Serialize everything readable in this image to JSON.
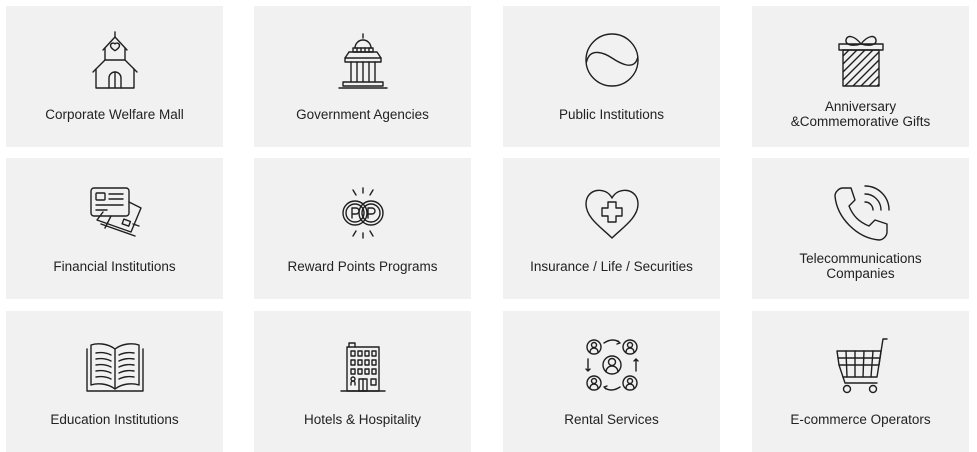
{
  "colors": {
    "card_background": "#f1f1f1",
    "text": "#222222",
    "icon_stroke": "#1f1f1f"
  },
  "categories": [
    {
      "label": "Corporate Welfare Mall",
      "icon": "house-heart-icon"
    },
    {
      "label": "Government Agencies",
      "icon": "government-building-icon"
    },
    {
      "label": "Public Institutions",
      "icon": "taegeuk-circle-icon"
    },
    {
      "label": "Anniversary\n&Commemorative Gifts",
      "icon": "gift-box-icon"
    },
    {
      "label": "Financial Institutions",
      "icon": "credit-cards-icon"
    },
    {
      "label": "Reward Points Programs",
      "icon": "point-coins-icon"
    },
    {
      "label": "Insurance / Life / Securities",
      "icon": "heart-cross-icon"
    },
    {
      "label": "Telecommunications\nCompanies",
      "icon": "phone-call-icon"
    },
    {
      "label": "Education Institutions",
      "icon": "open-book-icon"
    },
    {
      "label": "Hotels & Hospitality",
      "icon": "hotel-building-icon"
    },
    {
      "label": "Rental Services",
      "icon": "people-network-icon"
    },
    {
      "label": "E-commerce Operators",
      "icon": "shopping-cart-icon"
    }
  ]
}
